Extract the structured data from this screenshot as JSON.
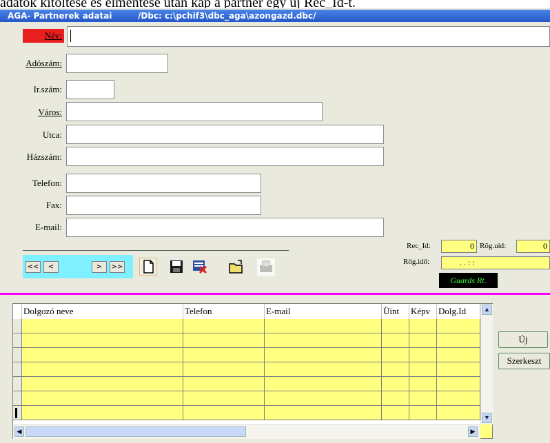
{
  "doc_caption": "adatok kitöltése és elmentése után kap a partner egy új Rec_Id-t.",
  "window": {
    "title": "AGA- Partnerek adatai",
    "path": "/Dbc: c:\\pchif3\\dbc_aga\\azongazd.dbc/"
  },
  "form": {
    "nev_label": "Név:",
    "adoszam_label": "Adószám:",
    "irszam_label": "Ir.szám:",
    "varos_label": "Város:",
    "utca_label": "Utca:",
    "hazszam_label": "Házszám:",
    "telefon_label": "Telefon:",
    "fax_label": "Fax:",
    "email_label": "E-mail:"
  },
  "nav": {
    "first": "<<",
    "prev": "<",
    "next": ">",
    "last": ">>"
  },
  "record": {
    "rec_id_label": "Rec_Id:",
    "rec_id_value": "0",
    "rog_uid_label": "Rög.uid:",
    "rog_uid_value": "0",
    "rog_ido_label": "Rög.idő:",
    "rog_ido_value": ". .   : :",
    "brand": "Guards Rt."
  },
  "grid": {
    "columns": [
      "Dolgozó neve",
      "Telefon",
      "E-mail",
      "Üint",
      "Képv",
      "Dolg.Id"
    ],
    "row_count": 7
  },
  "buttons": {
    "new": "Új",
    "edit": "Szerkeszt"
  },
  "colors": {
    "required_label": "#e8201e",
    "nav_panel": "#7ff0ff",
    "grid_cells": "#ffff80",
    "separator": "#ff00ff",
    "brand_text": "#3cff3c"
  }
}
